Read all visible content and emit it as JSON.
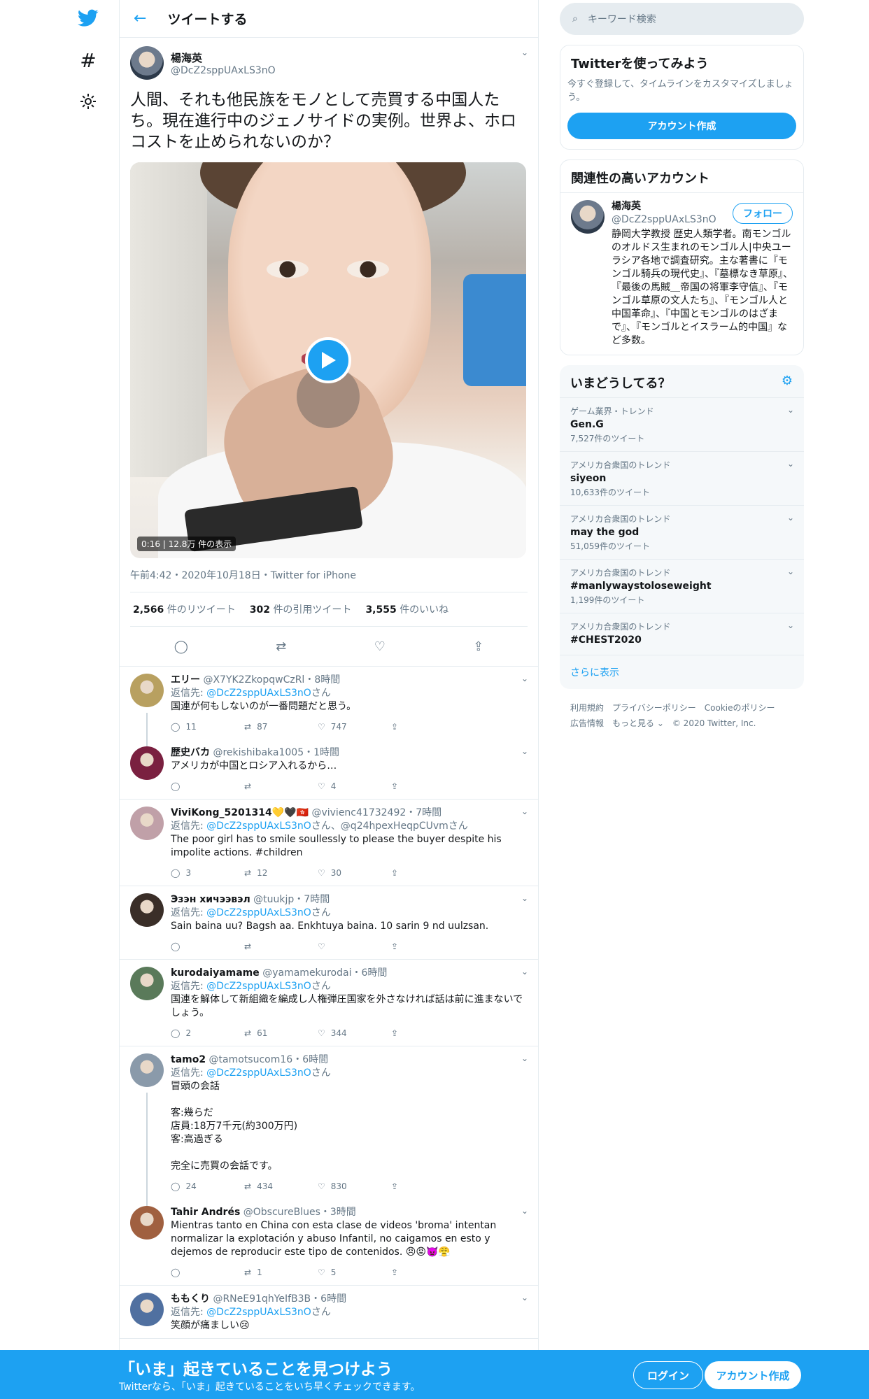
{
  "header": {
    "title": "ツイートする"
  },
  "tweet": {
    "name": "楊海英",
    "handle": "@DcZ2sppUAxLS3nO",
    "text": "人間、それも他民族をモノとして売買する中国人たち。現在進行中のジェノサイドの実例。世界よ、ホロコストを止められないのか？",
    "video_duration": "0:16",
    "video_views": "12.8万 件の表示",
    "meta": "午前4:42・2020年10月18日・Twitter for iPhone",
    "stats": [
      {
        "num": "2,566",
        "label": "件のリツイート"
      },
      {
        "num": "302",
        "label": "件の引用ツイート"
      },
      {
        "num": "3,555",
        "label": "件のいいね"
      }
    ]
  },
  "replies": [
    {
      "name": "エリー",
      "handle": "@X7YK2ZkopqwCzRl",
      "time": "8時間",
      "reply_to": "返信先:",
      "reply_target": "@DcZ2sppUAxLS3nO",
      "reply_suffix": "さん",
      "text": "国連が何もしないのが一番問題だと思う。",
      "counts": [
        "11",
        "87",
        "747",
        ""
      ],
      "avatar": "#b8a060"
    },
    {
      "name": "歴史バカ",
      "handle": "@rekishibaka1005",
      "time": "1時間",
      "reply_to": "",
      "reply_target": "",
      "reply_suffix": "",
      "text": "アメリカが中国とロシア入れるから…",
      "counts": [
        "",
        "",
        "4",
        ""
      ],
      "avatar": "#7a2040"
    },
    {
      "name": "ViviKong_5201314💛🖤🇭🇰",
      "handle": "@vivienc41732492",
      "time": "7時間",
      "reply_to": "返信先:",
      "reply_target": "@DcZ2sppUAxLS3nO",
      "reply_suffix": "さん、@q24hpexHeqpCUvmさん",
      "text": "The poor girl has to smile soullessly to please the buyer despite his impolite actions. #children",
      "counts": [
        "3",
        "12",
        "30",
        ""
      ],
      "avatar": "#c0a0a8"
    },
    {
      "name": "Эзэн хичээвэл",
      "handle": "@tuukjp",
      "time": "7時間",
      "reply_to": "返信先:",
      "reply_target": "@DcZ2sppUAxLS3nO",
      "reply_suffix": "さん",
      "text": "Sain baina uu? Bagsh aa. Enkhtuya baina. 10 sarin 9 nd uulzsan.",
      "counts": [
        "",
        "",
        "",
        ""
      ],
      "avatar": "#3a2e28"
    },
    {
      "name": "kurodaiyamame",
      "handle": "@yamamekurodai",
      "time": "6時間",
      "reply_to": "返信先:",
      "reply_target": "@DcZ2sppUAxLS3nO",
      "reply_suffix": "さん",
      "text": "国連を解体して新組織を編成し人権弾圧国家を外さなければ話は前に進まないでしょう。",
      "counts": [
        "2",
        "61",
        "344",
        ""
      ],
      "avatar": "#5a7a5a"
    },
    {
      "name": "tamo2",
      "handle": "@tamotsucom16",
      "time": "6時間",
      "reply_to": "返信先:",
      "reply_target": "@DcZ2sppUAxLS3nO",
      "reply_suffix": "さん",
      "text": "冒頭の会話\n\n客:幾らだ\n店員:18万7千元(約300万円)\n客:高過ぎる\n\n完全に売買の会話です。",
      "counts": [
        "24",
        "434",
        "830",
        ""
      ],
      "avatar": "#8a9aaa"
    },
    {
      "name": "Tahir Andrés",
      "handle": "@ObscureBlues",
      "time": "3時間",
      "reply_to": "",
      "reply_target": "",
      "reply_suffix": "",
      "text": "Mientras tanto en China con esta clase de videos 'broma' intentan normalizar la explotación y abuso Infantil, no caigamos en esto y dejemos de reproducir este tipo de contenidos. 😠😡👿😤",
      "counts": [
        "",
        "1",
        "5",
        ""
      ],
      "avatar": "#a06040"
    },
    {
      "name": "ももくり",
      "handle": "@RNeE91qhYeIfB3B",
      "time": "6時間",
      "reply_to": "返信先:",
      "reply_target": "@DcZ2sppUAxLS3nO",
      "reply_suffix": "さん",
      "text": "笑顔が痛ましい😢",
      "counts": [
        "",
        "",
        "",
        ""
      ],
      "avatar": "#5070a0"
    }
  ],
  "right": {
    "search_placeholder": "キーワード検索",
    "signup_card": {
      "title": "Twitterを使ってみよう",
      "desc": "今すぐ登録して、タイムラインをカスタマイズしましょう。",
      "button": "アカウント作成"
    },
    "related": {
      "title": "関連性の高いアカウント",
      "name": "楊海英",
      "handle": "@DcZ2sppUAxLS3nO",
      "follow": "フォロー",
      "bio": "静岡大学教授 歴史人類学者。南モンゴルのオルドス生まれのモンゴル人|中央ユーラシア各地で調査研究。主な著書に『モンゴル騎兵の現代史』、『墓標なき草原』、『最後の馬賊＿帝国の将軍李守信』、『モンゴル草原の文人たち』、『モンゴル人と中国革命』、『中国とモンゴルのはざまで』、『モンゴルとイスラーム的中国』など多数。"
    },
    "trends": {
      "title": "いまどうしてる？",
      "items": [
        {
          "cat": "ゲーム業界・トレンド",
          "t": "Gen.G",
          "cnt": "7,527件のツイート"
        },
        {
          "cat": "アメリカ合衆国のトレンド",
          "t": "siyeon",
          "cnt": "10,633件のツイート"
        },
        {
          "cat": "アメリカ合衆国のトレンド",
          "t": "may the god",
          "cnt": "51,059件のツイート"
        },
        {
          "cat": "アメリカ合衆国のトレンド",
          "t": "#manlywaystoloseweight",
          "cnt": "1,199件のツイート"
        },
        {
          "cat": "アメリカ合衆国のトレンド",
          "t": "#CHEST2020",
          "cnt": ""
        }
      ],
      "more": "さらに表示"
    },
    "footer": {
      "line1": "利用規約　プライバシーポリシー　Cookieのポリシー",
      "line2": "広告情報　もっと見る ⌄　© 2020 Twitter, Inc."
    }
  },
  "bottom": {
    "title": "「いま」起きていることを見つけよう",
    "sub": "Twitterなら、「いま」起きていることをいち早くチェックできます。",
    "login": "ログイン",
    "signup": "アカウント作成"
  },
  "colors": {
    "accent": "#1da1f2",
    "text": "#14171a",
    "muted": "#657786"
  }
}
